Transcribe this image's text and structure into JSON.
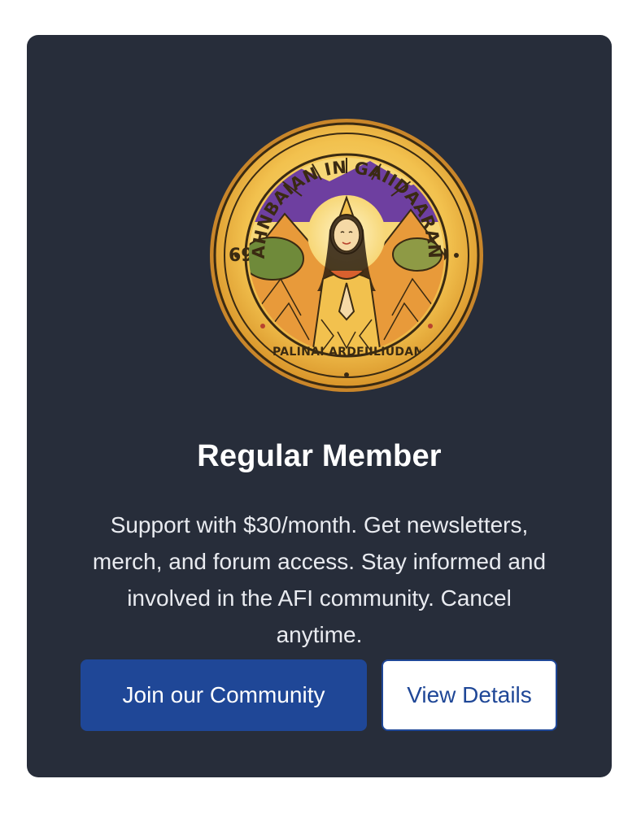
{
  "card": {
    "emblem": {
      "icon": "membership-seal-icon",
      "top_text": "AHNBAIAN IN GAIIDAARAN",
      "bottom_text": "PALINAI ARDFIILIUDAM",
      "colors": {
        "gold": "#f2c14e",
        "rim": "#d9952a",
        "purple": "#6e3fa0",
        "outline": "#3a2a12"
      }
    },
    "title": "Regular Member",
    "description": "Support with $30/month. Get newsletters, merch, and forum access. Stay informed and involved in the AFI community. Cancel anytime.",
    "buttons": {
      "primary_label": "Join our Community",
      "secondary_label": "View Details"
    },
    "colors": {
      "background": "#272d3a",
      "accent": "#1f4797",
      "title_text": "#ffffff",
      "body_text": "#e9ebf0"
    }
  }
}
